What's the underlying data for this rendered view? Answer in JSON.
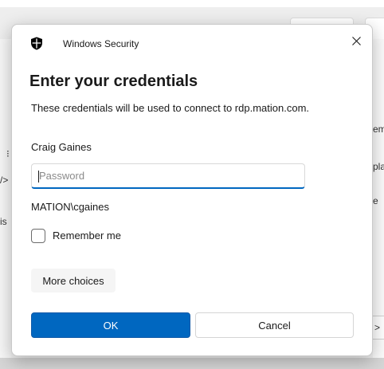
{
  "background": {
    "left_fragments": [
      "⁝",
      "/>",
      "is"
    ],
    "right_fragments": [
      "em",
      "pla",
      "e"
    ],
    "right_button_glyph": ">"
  },
  "dialog": {
    "title": "Windows Security",
    "heading": "Enter your credentials",
    "description": "These credentials will be used to connect to rdp.mation.com.",
    "username": "Craig Gaines",
    "password": {
      "value": "",
      "placeholder": "Password"
    },
    "domain_user": "MATION\\cgaines",
    "remember_me": {
      "label": "Remember me",
      "checked": false
    },
    "more_choices_label": "More choices",
    "ok_label": "OK",
    "cancel_label": "Cancel",
    "icons": {
      "title": "shield-icon",
      "close": "close-icon"
    }
  },
  "colors": {
    "accent": "#0067c0",
    "text": "#1a1a1a",
    "placeholder": "#8a8a8a"
  }
}
